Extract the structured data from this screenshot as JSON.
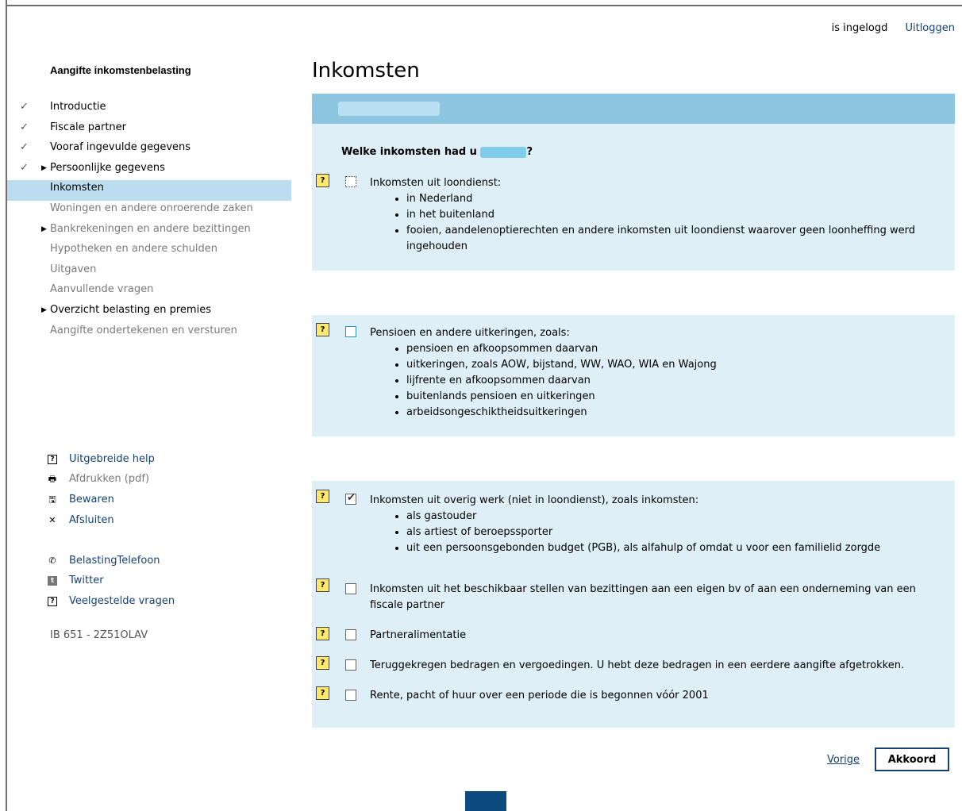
{
  "topbar": {
    "user_text": "is ingelogd",
    "logout": "Uitloggen"
  },
  "sidebar": {
    "title": "Aangifte inkomstenbelasting",
    "items": [
      {
        "label": "Introductie",
        "check": "✓",
        "arrow": "",
        "state": "done"
      },
      {
        "label": "Fiscale partner",
        "check": "✓",
        "arrow": "",
        "state": "done"
      },
      {
        "label": "Vooraf ingevulde gegevens",
        "check": "✓",
        "arrow": "",
        "state": "done"
      },
      {
        "label": "Persoonlijke gegevens",
        "check": "✓",
        "arrow": "▶",
        "state": "done"
      },
      {
        "label": "Inkomsten",
        "check": "",
        "arrow": "",
        "state": "active"
      },
      {
        "label": "Woningen en andere onroerende zaken",
        "check": "",
        "arrow": "",
        "state": "muted"
      },
      {
        "label": "Bankrekeningen en andere bezittingen",
        "check": "",
        "arrow": "▶",
        "state": "muted"
      },
      {
        "label": "Hypotheken en andere schulden",
        "check": "",
        "arrow": "",
        "state": "muted"
      },
      {
        "label": "Uitgaven",
        "check": "",
        "arrow": "",
        "state": "muted"
      },
      {
        "label": "Aanvullende vragen",
        "check": "",
        "arrow": "",
        "state": "muted"
      },
      {
        "label": "Overzicht belasting en premies",
        "check": "",
        "arrow": "▶",
        "state": "normal"
      },
      {
        "label": "Aangifte ondertekenen en versturen",
        "check": "",
        "arrow": "",
        "state": "muted"
      }
    ],
    "links": {
      "help": "Uitgebreide help",
      "print": "Afdrukken (pdf)",
      "save": "Bewaren",
      "close": "Afsluiten",
      "phone": "BelastingTelefoon",
      "twitter": "Twitter",
      "faq": "Veelgestelde vragen"
    },
    "code": "IB 651 - 2Z51OLAV"
  },
  "main": {
    "title": "Inkomsten",
    "question_prefix": "Welke inkomsten had u",
    "question_suffix": "?",
    "help_glyph": "?",
    "groups": [
      {
        "label": "Inkomsten uit loondienst:",
        "checked": false,
        "bullets": [
          "in Nederland",
          "in het buitenland",
          "fooien, aandelenoptierechten en andere inkomsten uit loondienst waarover geen loonheffing werd ingehouden"
        ]
      },
      {
        "label": "Pensioen en andere uitkeringen, zoals:",
        "checked": false,
        "bullets": [
          "pensioen en afkoopsommen daarvan",
          "uitkeringen, zoals AOW, bijstand, WW, WAO, WIA en Wajong",
          "lijfrente en afkoopsommen daarvan",
          "buitenlands pensioen en uitkeringen",
          "arbeidsongeschiktheidsuitkeringen"
        ]
      },
      {
        "label": "Inkomsten uit overig werk (niet in loondienst), zoals inkomsten:",
        "checked": true,
        "bullets": [
          "als gastouder",
          "als artiest of beroepssporter",
          "uit een persoonsgebonden budget (PGB), als alfahulp of omdat u voor een familielid zorgde"
        ]
      },
      {
        "label": "Inkomsten uit het beschikbaar stellen van bezittingen aan een eigen bv of aan een onderneming van een fiscale partner",
        "checked": false,
        "bullets": []
      },
      {
        "label": "Partneralimentatie",
        "checked": false,
        "bullets": []
      },
      {
        "label": "Teruggekregen bedragen en vergoedingen. U hebt deze bedragen in een eerdere aangifte afgetrokken.",
        "checked": false,
        "bullets": []
      },
      {
        "label": "Rente, pacht of huur over een periode die is begonnen vóór 2001",
        "checked": false,
        "bullets": []
      }
    ]
  },
  "footer": {
    "prev": "Vorige",
    "ok": "Akkoord"
  },
  "colors": {
    "accent": "#154273",
    "band": "#8ec6e1",
    "panel": "#dfeff8",
    "active_nav": "#bcdcef",
    "help_yellow": "#ffe86a"
  }
}
